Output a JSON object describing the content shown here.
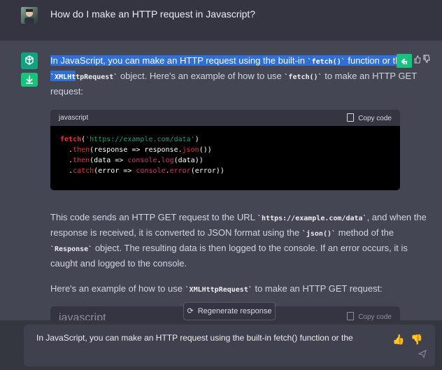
{
  "user": {
    "question": "How do I make an HTTP request in Javascript?"
  },
  "answer": {
    "line1_a": "In JavaScript, you can make an HTTP request using the built-in ",
    "line1_code": "`fetch()`",
    "line1_b": " function or the",
    "line2_code_a": "`XMLHt",
    "line2_code_b": "tpRequest`",
    "line2_b": " object. Here's an example of how to use ",
    "line2_code_c": "`fetch()`",
    "line2_c": " to make an HTTP GET",
    "line3": "request:"
  },
  "code_block": {
    "language": "javascript",
    "copy_label": "Copy code",
    "line1": {
      "fn": "fetch",
      "p1": "(",
      "str": "'https://example.com/data'",
      "p2": ")"
    },
    "line2": {
      "dot": "  .",
      "fn": "then",
      "a": "(response => response.",
      "m": "json",
      "b": "())"
    },
    "line3": {
      "dot": "  .",
      "fn": "then",
      "a": "(data => ",
      "c1": "console",
      "d": ".",
      "m": "log",
      "b": "(data))"
    },
    "line4": {
      "dot": "  .",
      "fn": "catch",
      "a": "(error => ",
      "c1": "console",
      "d": ".",
      "m": "error",
      "b": "(error))"
    }
  },
  "explanation": {
    "l1_a": "This code sends an HTTP GET request to the URL ",
    "l1_code": "`https://example.com/data`",
    "l1_b": ", and when the",
    "l2_a": "response is received, it is converted to JSON format using the ",
    "l2_code": "`json()`",
    "l2_b": " method of the",
    "l3_code": "`Response`",
    "l3_b": " object. The resulting data is then logged to the console. If an error occurs, it is",
    "l4": "caught and logged to the console."
  },
  "second_intro": {
    "a": "Here's an example of how to use ",
    "code": "`XMLHttpRequest`",
    "b": " to make an HTTP GET request:"
  },
  "code_block2": {
    "language": "javascript",
    "copy_label": "Copy code"
  },
  "regenerate_label": "Regenerate response",
  "input": {
    "value": "In JavaScript, you can make an HTTP request using the built-in fetch() function or the",
    "emoji_thumbs_up": "👍",
    "emoji_thumbs_down": "👎"
  },
  "icons": {
    "reply": "reply-arrow-icon",
    "copy": "clipboard-icon",
    "thumb_down": "thumbs-down-icon",
    "regenerate": "refresh-icon",
    "send": "send-icon"
  },
  "colors": {
    "brand_green": "#10a37f",
    "highlight": "#2f6fd6",
    "background": "#444654"
  }
}
